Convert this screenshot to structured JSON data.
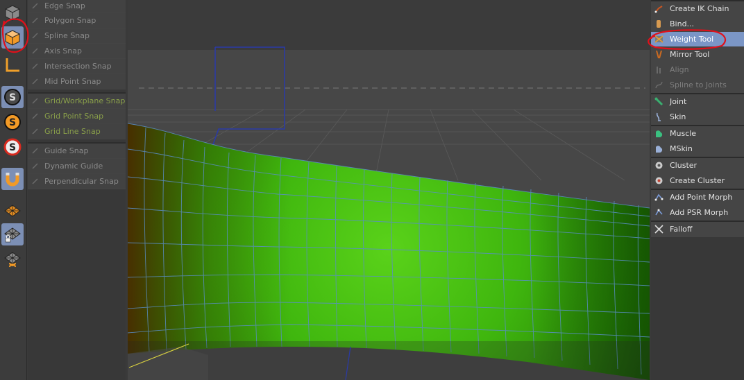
{
  "snap_menu": {
    "items": [
      {
        "label": "Edge Snap"
      },
      {
        "label": "Polygon Snap"
      },
      {
        "label": "Spline Snap"
      },
      {
        "label": "Axis Snap"
      },
      {
        "label": "Intersection Snap"
      },
      {
        "label": "Mid Point Snap"
      },
      {
        "label": "Grid/Workplane Snap"
      },
      {
        "label": "Grid Point Snap"
      },
      {
        "label": "Grid Line Snap"
      },
      {
        "label": "Guide Snap"
      },
      {
        "label": "Dynamic Guide"
      },
      {
        "label": "Perpendicular Snap"
      }
    ]
  },
  "character_menu": {
    "items": [
      {
        "label": "Create IK Chain",
        "icon": "ik-chain-icon"
      },
      {
        "label": "Bind...",
        "icon": "bind-icon"
      },
      {
        "label": "Weight Tool",
        "icon": "weight-tool-icon"
      },
      {
        "label": "Mirror Tool",
        "icon": "mirror-tool-icon"
      },
      {
        "label": "Align",
        "icon": "align-icon"
      },
      {
        "label": "Spline to Joints",
        "icon": "spline-to-joints-icon"
      },
      {
        "label": "Joint",
        "icon": "joint-icon"
      },
      {
        "label": "Skin",
        "icon": "skin-icon"
      },
      {
        "label": "Muscle",
        "icon": "muscle-icon"
      },
      {
        "label": "MSkin",
        "icon": "mskin-icon"
      },
      {
        "label": "Cluster",
        "icon": "cluster-icon"
      },
      {
        "label": "Create Cluster",
        "icon": "create-cluster-icon"
      },
      {
        "label": "Add Point Morph",
        "icon": "add-point-morph-icon"
      },
      {
        "label": "Add PSR Morph",
        "icon": "add-psr-morph-icon"
      },
      {
        "label": "Falloff",
        "icon": "falloff-icon"
      }
    ],
    "selected": "Weight Tool"
  },
  "left_toolbar": {
    "tools": [
      "model-mode-icon",
      "object-mode-icon",
      "axis-mode-icon",
      "snap-settings-icon",
      "snap-enable-icon",
      "snap-off-icon",
      "magnet-icon",
      "workplane-icon",
      "locked-workplane-icon",
      "workplane-axis-icon"
    ],
    "active": "object-mode-icon"
  },
  "colors": {
    "accent": "#7b96c6",
    "mesh_green": "#44cc10",
    "annotation_red": "#e0101a"
  }
}
